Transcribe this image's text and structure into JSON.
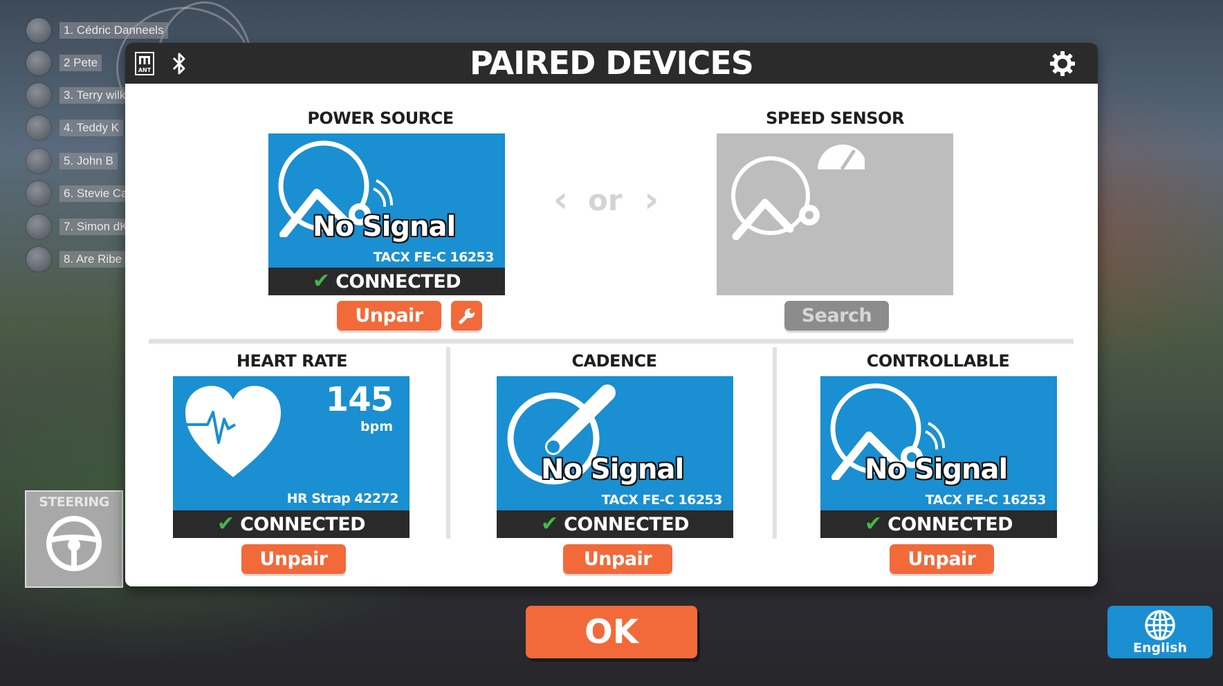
{
  "leaderboard": [
    {
      "label": "1. Cédric Danneels"
    },
    {
      "label": "2 Pete"
    },
    {
      "label": "3. Terry wilk"
    },
    {
      "label": "4. Teddy K"
    },
    {
      "label": "5. John B"
    },
    {
      "label": "6. Stevie Ca"
    },
    {
      "label": "7. Simon dK"
    },
    {
      "label": "8. Are Ribe"
    }
  ],
  "modal": {
    "title": "PAIRED DEVICES",
    "header_icons": [
      "ant-icon",
      "bluetooth-icon",
      "gear-icon"
    ],
    "ant_label": "ANT"
  },
  "power_source": {
    "title": "POWER SOURCE",
    "signal": "No Signal",
    "device": "TACX FE-C 16253",
    "status": "CONNECTED",
    "unpair_label": "Unpair"
  },
  "or_label": "or",
  "speed_sensor": {
    "title": "SPEED SENSOR",
    "search_label": "Search"
  },
  "heart_rate": {
    "title": "HEART RATE",
    "value": "145",
    "unit": "bpm",
    "device": "HR Strap 42272",
    "status": "CONNECTED",
    "unpair_label": "Unpair"
  },
  "cadence": {
    "title": "CADENCE",
    "signal": "No Signal",
    "device": "TACX FE-C 16253",
    "status": "CONNECTED",
    "unpair_label": "Unpair"
  },
  "controllable": {
    "title": "CONTROLLABLE",
    "signal": "No Signal",
    "device": "TACX FE-C 16253",
    "status": "CONNECTED",
    "unpair_label": "Unpair"
  },
  "steering": {
    "label": "STEERING"
  },
  "ok_label": "OK",
  "language": {
    "label": "English"
  },
  "colors": {
    "accent": "#f26a3a",
    "tile_blue": "#1a8fd1",
    "connected_green": "#43b649"
  }
}
